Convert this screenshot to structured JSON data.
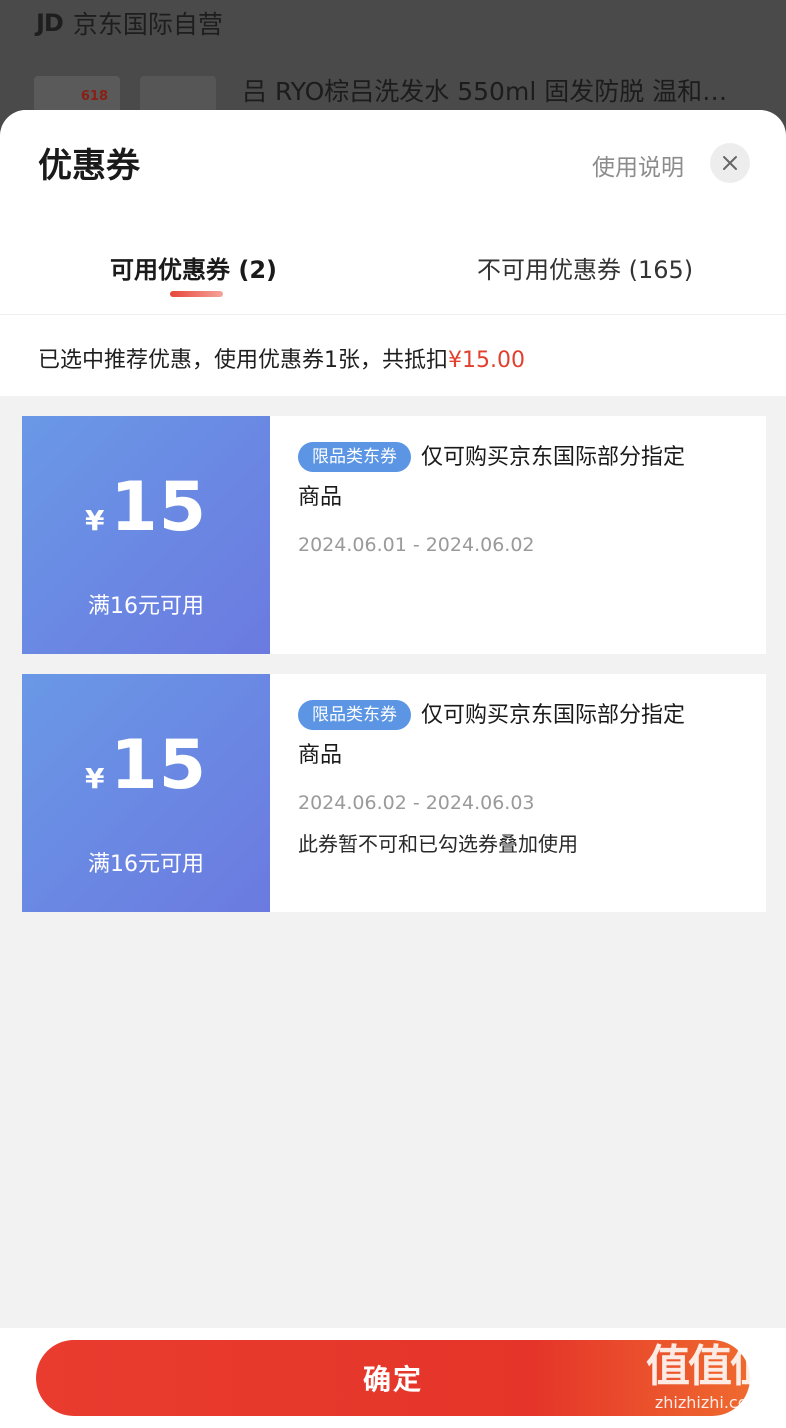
{
  "background": {
    "store_logo": "JD",
    "store_name": "京东国际自营",
    "product_tag": "618",
    "product_title": "吕 RYO棕吕洗发水 550ml 固发防脱 温和…"
  },
  "sheet": {
    "title": "优惠券",
    "help_link": "使用说明",
    "close_icon": "close-icon"
  },
  "tabs": [
    {
      "label": "可用优惠券 (2)",
      "active": true
    },
    {
      "label": "不可用优惠券 (165)",
      "active": false
    }
  ],
  "summary": {
    "text": "已选中推荐优惠，使用优惠券1张，共抵扣",
    "amount": "¥15.00"
  },
  "coupons": [
    {
      "currency": "¥",
      "amount": "15",
      "threshold": "满16元可用",
      "badge": "限品类东券",
      "description": "仅可购买京东国际部分指定商品",
      "validity": "2024.06.01 - 2024.06.02",
      "note": "",
      "selected": true
    },
    {
      "currency": "¥",
      "amount": "15",
      "threshold": "满16元可用",
      "badge": "限品类东券",
      "description": "仅可购买京东国际部分指定商品",
      "validity": "2024.06.02 - 2024.06.03",
      "note": "此券暂不可和已勾选券叠加使用",
      "selected": false
    }
  ],
  "footer": {
    "confirm_label": "确定"
  },
  "watermark": {
    "big": "值值值",
    "small": "zhizhizhi.com"
  },
  "colors": {
    "accent_red": "#e4393c",
    "coupon_blue_start": "#6a98e6",
    "coupon_blue_end": "#6b7ae0",
    "badge_blue": "#5b95e3"
  }
}
